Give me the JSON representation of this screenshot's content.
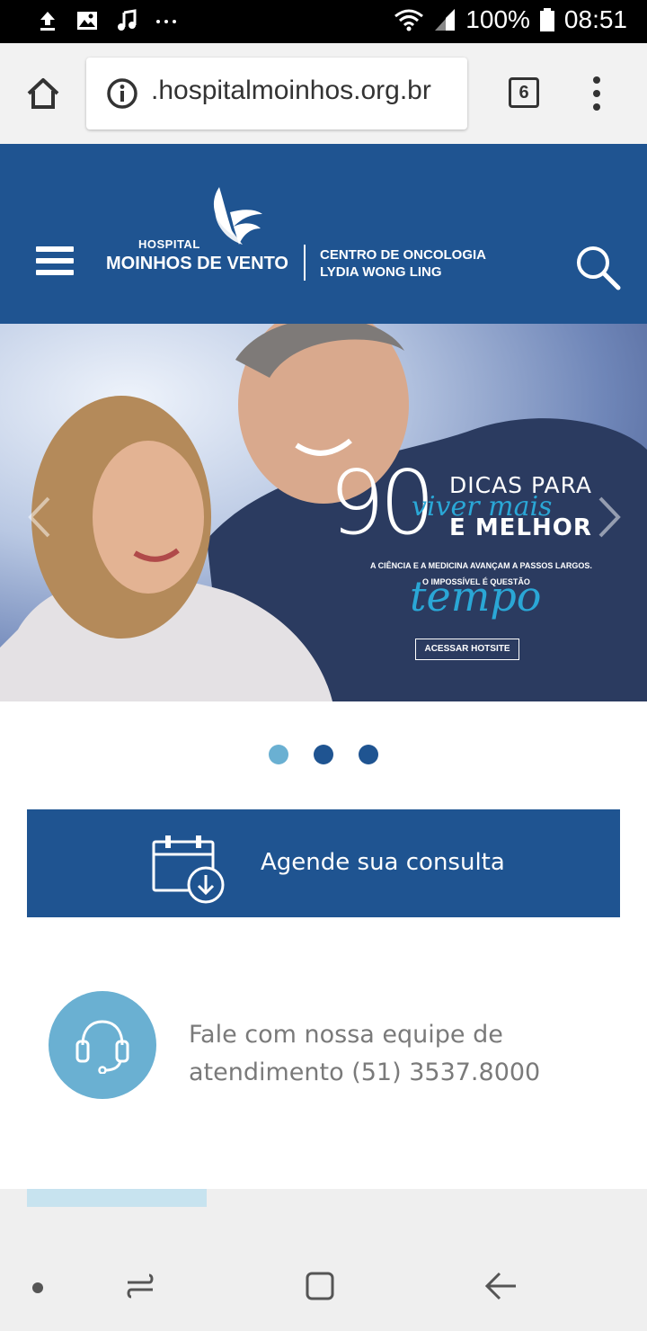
{
  "status_bar": {
    "battery": "100%",
    "time": "08:51",
    "icons": [
      "upload-icon",
      "image-icon",
      "music-icon",
      "more-dots-icon",
      "wifi-icon",
      "signal-icon",
      "battery-icon"
    ]
  },
  "browser": {
    "url": ".hospitalmoinhos.org.br",
    "tab_count": "6",
    "icons": [
      "home-icon",
      "info-icon",
      "overflow-menu-icon"
    ]
  },
  "header": {
    "logo_small": "HOSPITAL",
    "logo_main": "MOINHOS DE VENTO",
    "center_line1": "CENTRO DE ONCOLOGIA",
    "center_line2": "LYDIA WONG LING",
    "icons": [
      "hamburger-menu-icon",
      "search-icon",
      "wing-logo-icon"
    ]
  },
  "hero": {
    "number": "90",
    "dicas": "DICAS PARA",
    "viver": "viver mais",
    "melhor": "E MELHOR",
    "sub1": "A CIÊNCIA E A MEDICINA AVANÇAM A PASSOS LARGOS.",
    "sub2": "O IMPOSSÍVEL É QUESTÃO",
    "tempo": "tempo",
    "button": "ACESSAR HOTSITE"
  },
  "carousel": {
    "active_index": 0,
    "count": 3
  },
  "cta": {
    "label": "Agende sua consulta",
    "icon": "calendar-download-icon"
  },
  "support": {
    "line1": "Fale com nossa equipe de",
    "line2": "atendimento (51) 3537.8000",
    "icon": "headset-icon"
  },
  "colors": {
    "brand_blue": "#1f5491",
    "light_blue": "#6ab0d2",
    "teal_script": "#2aa7d6"
  }
}
